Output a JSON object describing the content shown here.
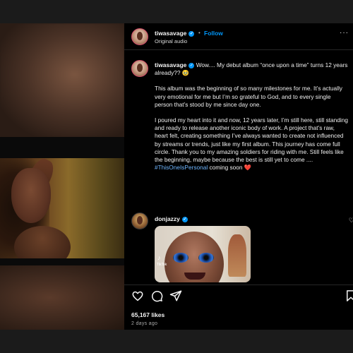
{
  "post": {
    "username": "tiwasavage",
    "follow_label": "Follow",
    "dot": "•",
    "audio_label": "Original audio",
    "more_label": "···"
  },
  "caption": {
    "username": "tiwasavage",
    "intro": "Wow.... My debut album “once upon a time” turns 12 years already?? 🥹",
    "para1": "This album was the beginning of so many milestones for me. It’s actually very emotional for me but I’m so grateful to God, and to every single person that’s stood by me since day one.",
    "para2": "I poured my heart into it and now, 12 years later, I’m still here, still standing and ready to release another iconic body of work. A project that’s raw, heart felt, creating something I’ve always wanted to create not influenced by streams or trends, just like my first album. This journey has come full circle. Thank you to my amazing soldiers for riding with me. Still feels like the beginning, maybe because the best is still yet to come ....",
    "hashtag": "#ThisOneIsPersonal",
    "coming_soon": "coming soon",
    "heart_emoji": "❤️",
    "age": "2d"
  },
  "comment": {
    "username": "donjazzy",
    "sticker_logo": "♪",
    "sticker_label": "TikTok"
  },
  "actions": {
    "likes": "65,167 likes",
    "time_ago": "2 days ago",
    "icons": [
      "heart-icon",
      "comment-icon",
      "share-icon",
      "bookmark-icon"
    ]
  },
  "colors": {
    "accent": "#0095f6",
    "hashtag": "#6fb6ff",
    "heart": "#ff3d6e",
    "background": "#000000"
  }
}
